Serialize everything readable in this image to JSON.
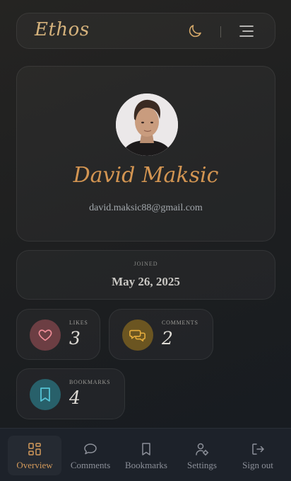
{
  "header": {
    "logo": "Ethos",
    "theme_icon": "moon-icon",
    "menu_icon": "hamburger-menu-icon"
  },
  "profile": {
    "avatar_icon": "user-avatar-photo",
    "name": "David Maksic",
    "email": "david.maksic88@gmail.com"
  },
  "joined": {
    "label": "JOINED",
    "date": "May 26, 2025"
  },
  "stats": [
    {
      "label": "LIKES",
      "value": "3",
      "icon": "heart-icon",
      "color": "#e47c89"
    },
    {
      "label": "COMMENTS",
      "value": "2",
      "icon": "chat-bubbles-icon",
      "color": "#d9a338"
    },
    {
      "label": "BOOKMARKS",
      "value": "4",
      "icon": "bookmark-icon",
      "color": "#4cb6c7"
    }
  ],
  "nav": [
    {
      "label": "Overview",
      "icon": "dashboard-grid-icon",
      "active": true
    },
    {
      "label": "Comments",
      "icon": "comment-icon",
      "active": false
    },
    {
      "label": "Bookmarks",
      "icon": "bookmark-icon",
      "active": false
    },
    {
      "label": "Settings",
      "icon": "user-settings-icon",
      "active": false
    },
    {
      "label": "Sign out",
      "icon": "sign-out-icon",
      "active": false
    }
  ],
  "colors": {
    "accent": "#d39552",
    "logo": "#d5b27c",
    "nav_bg": "#1d222a"
  }
}
